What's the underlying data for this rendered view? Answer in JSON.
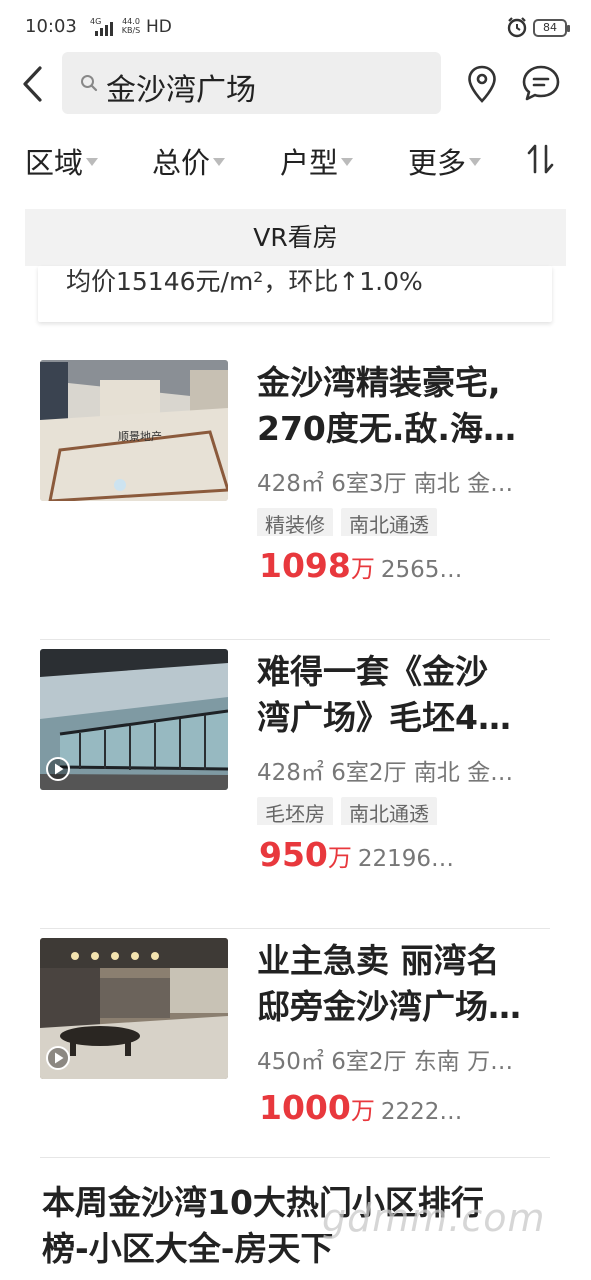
{
  "status_bar": {
    "time": "10:03",
    "network": "4G",
    "speed_value": "44.0",
    "speed_unit": "KB/S",
    "hd": "HD",
    "battery": "84"
  },
  "search": {
    "query": "金沙湾广场"
  },
  "filters": [
    {
      "label": "区域"
    },
    {
      "label": "总价"
    },
    {
      "label": "户型"
    },
    {
      "label": "更多"
    }
  ],
  "vr_label": "VR看房",
  "partial_card_text": "均价15146元/m²，环比↑1.0%",
  "listings": [
    {
      "title_line1": "金沙湾精装豪宅,",
      "title_line2": "270度无.敌.海…",
      "info": "428㎡ 6室3厅 南北 金…",
      "tags": [
        "精装修",
        "南北通透"
      ],
      "price": "1098",
      "price_unit": "万",
      "unit_price": "2565…",
      "thumb_caption": "顺景地产",
      "has_video": false
    },
    {
      "title_line1": "难得一套《金沙",
      "title_line2": "湾广场》毛坯4…",
      "info": "428㎡ 6室2厅 南北 金…",
      "tags": [
        "毛坯房",
        "南北通透"
      ],
      "price": "950",
      "price_unit": "万",
      "unit_price": "22196…",
      "has_video": true
    },
    {
      "title_line1": "业主急卖 丽湾名",
      "title_line2": "邸旁金沙湾广场…",
      "info": "450㎡ 6室2厅 东南 万…",
      "tags": [],
      "price": "1000",
      "price_unit": "万",
      "unit_price": "2222…",
      "has_video": true
    }
  ],
  "ranking": {
    "line1": "本周金沙湾10大热门小区排行",
    "line2": "榜-小区大全-房天下"
  },
  "watermark": "gdmm.com",
  "colors": {
    "price_red": "#e8383d",
    "tag_bg": "#f1f1f1",
    "search_bg": "#eeeeee"
  }
}
